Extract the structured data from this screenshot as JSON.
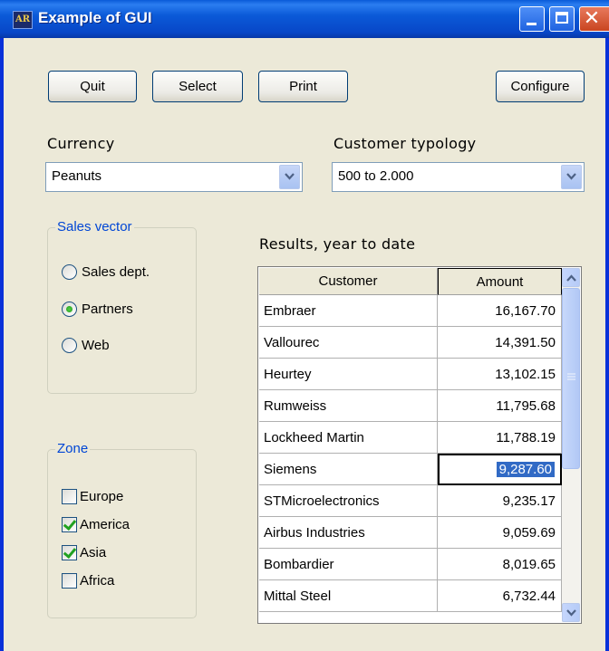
{
  "window": {
    "title": "Example of GUI",
    "icon_name": "app-logo-icon"
  },
  "toolbar": {
    "quit_label": "Quit",
    "select_label": "Select",
    "print_label": "Print",
    "configure_label": "Configure"
  },
  "currency": {
    "label": "Currency",
    "value": "Peanuts"
  },
  "typology": {
    "label": "Customer typology",
    "value": "500 to 2.000"
  },
  "sales_vector": {
    "title": "Sales vector",
    "options": [
      {
        "label": "Sales dept.",
        "selected": false
      },
      {
        "label": "Partners",
        "selected": true
      },
      {
        "label": "Web",
        "selected": false
      }
    ]
  },
  "zone": {
    "title": "Zone",
    "options": [
      {
        "label": "Europe",
        "checked": false
      },
      {
        "label": "America",
        "checked": true
      },
      {
        "label": "Asia",
        "checked": true
      },
      {
        "label": "Africa",
        "checked": false
      }
    ]
  },
  "results": {
    "caption": "Results, year to date",
    "columns": [
      "Customer",
      "Amount"
    ],
    "rows": [
      {
        "customer": "Embraer",
        "amount": "16,167.70"
      },
      {
        "customer": "Vallourec",
        "amount": "14,391.50"
      },
      {
        "customer": "Heurtey",
        "amount": "13,102.15"
      },
      {
        "customer": "Rumweiss",
        "amount": "11,795.68"
      },
      {
        "customer": "Lockheed Martin",
        "amount": "11,788.19"
      },
      {
        "customer": "Siemens",
        "amount": "9,287.60"
      },
      {
        "customer": "STMicroelectronics",
        "amount": "9,235.17"
      },
      {
        "customer": "Airbus Industries",
        "amount": "9,059.69"
      },
      {
        "customer": "Bombardier",
        "amount": "8,019.65"
      },
      {
        "customer": "Mittal Steel",
        "amount": "6,732.44"
      }
    ],
    "selected_row": 5
  },
  "colors": {
    "titlebar": "#0a5bd8",
    "window_bg": "#ece9d8",
    "group_title": "#0046d5",
    "selection": "#316ac5"
  }
}
